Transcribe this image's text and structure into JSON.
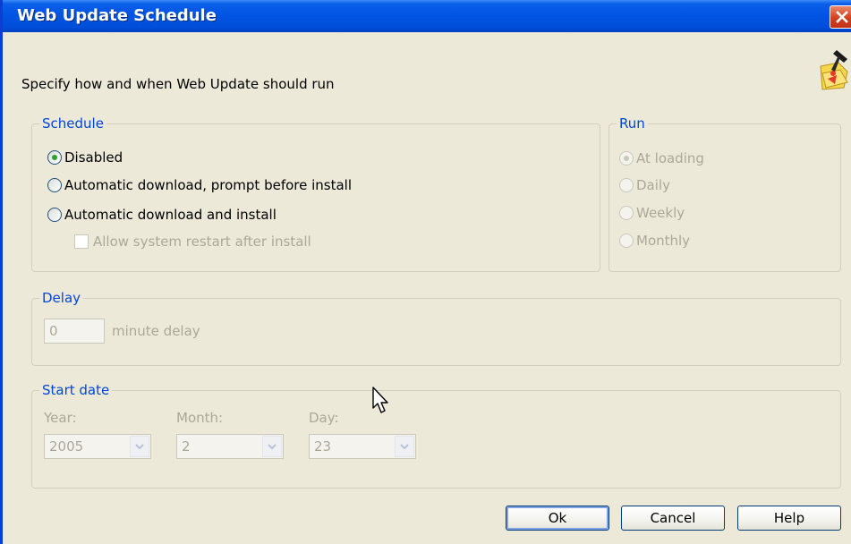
{
  "window": {
    "title": "Web Update Schedule"
  },
  "description": "Specify how and when Web Update should run",
  "schedule": {
    "legend": "Schedule",
    "options": [
      {
        "label": "Disabled",
        "checked": true
      },
      {
        "label": "Automatic download, prompt before install",
        "checked": false
      },
      {
        "label": "Automatic download and install",
        "checked": false
      }
    ],
    "restart_label": "Allow system restart after install"
  },
  "run": {
    "legend": "Run",
    "options": [
      {
        "label": "At loading",
        "checked": true
      },
      {
        "label": "Daily",
        "checked": false
      },
      {
        "label": "Weekly",
        "checked": false
      },
      {
        "label": "Monthly",
        "checked": false
      }
    ]
  },
  "delay": {
    "legend": "Delay",
    "value": "0",
    "suffix": "minute delay"
  },
  "start_date": {
    "legend": "Start date",
    "year_label": "Year:",
    "year_value": "2005",
    "month_label": "Month:",
    "month_value": "2",
    "day_label": "Day:",
    "day_value": "23"
  },
  "buttons": {
    "ok": "Ok",
    "cancel": "Cancel",
    "help": "Help"
  },
  "colors": {
    "titlebar": "#0054e3",
    "legend": "#0046d5",
    "face": "#ece9d8"
  }
}
